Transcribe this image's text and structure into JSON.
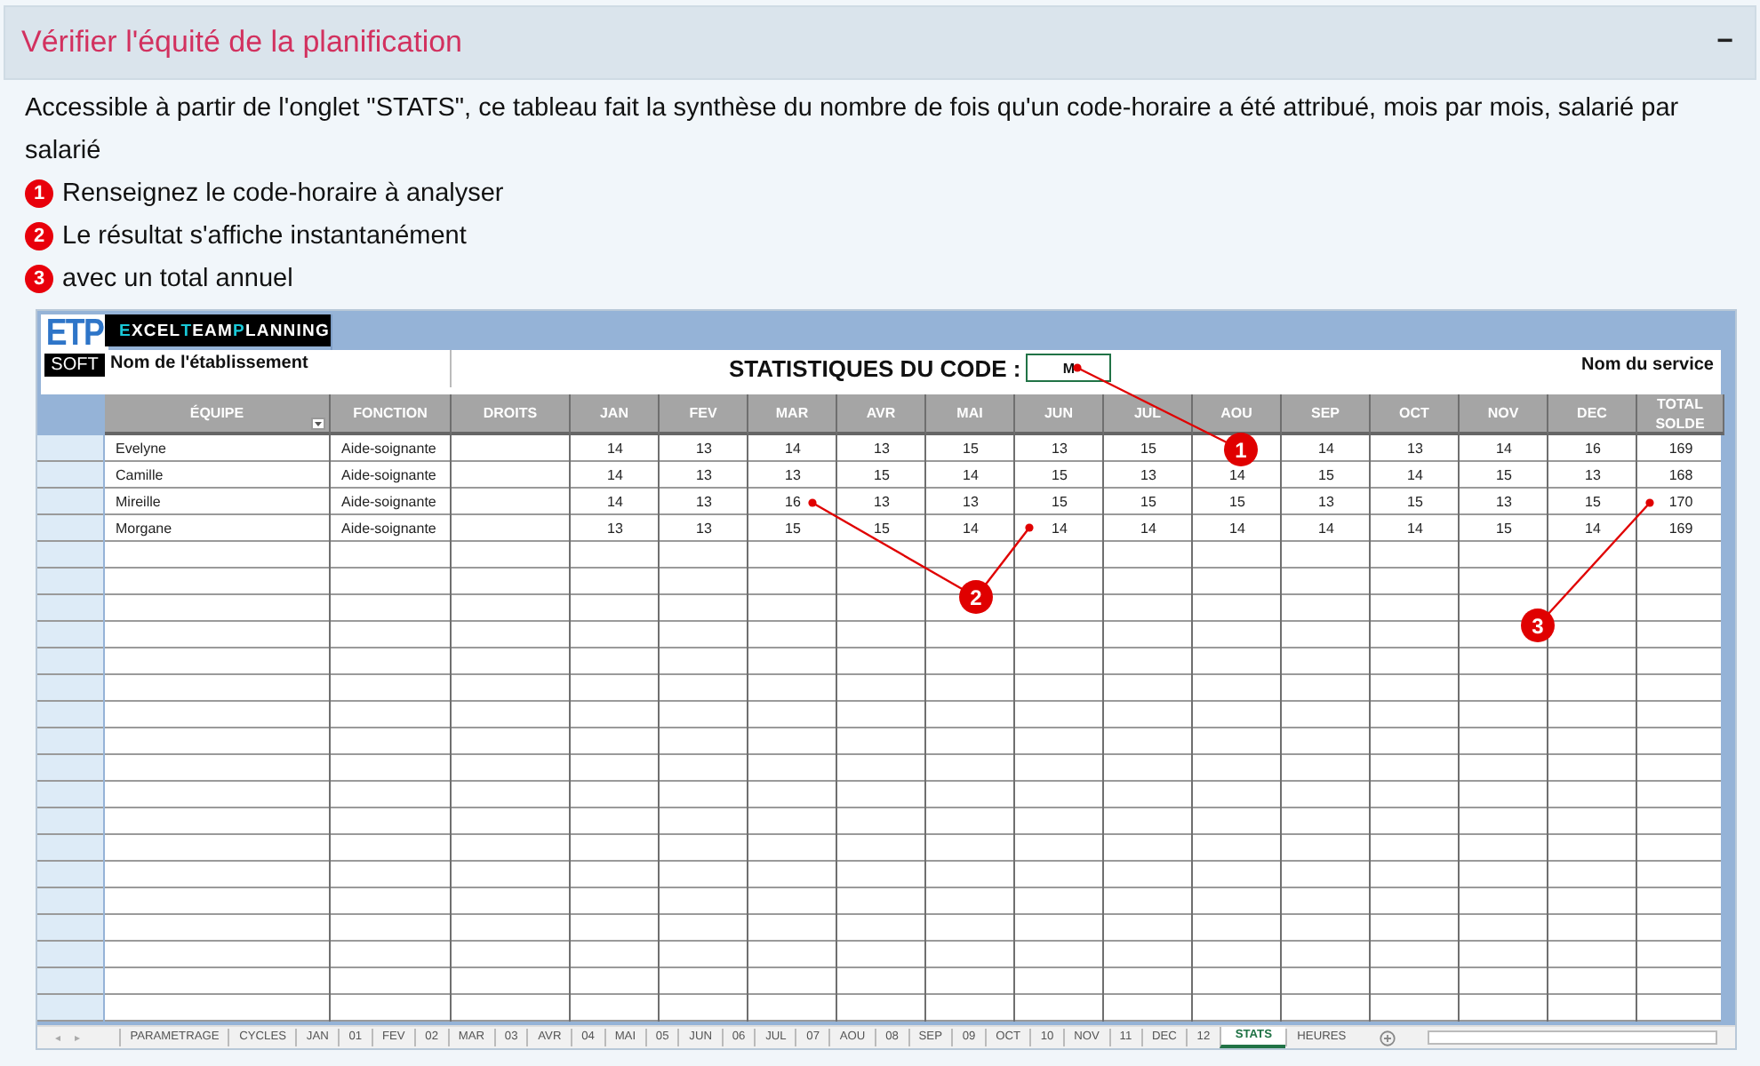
{
  "section": {
    "title": "Vérifier l'équité de la planification",
    "toggle": "−"
  },
  "intro": "Accessible à partir de l'onglet \"STATS\", ce tableau fait la synthèse du nombre de fois qu'un code-horaire a été attribué, mois par mois, salarié par salarié",
  "steps": [
    {
      "number": "1",
      "text": "Renseignez le code-horaire à analyser"
    },
    {
      "number": "2",
      "text": "Le résultat s'affiche instantanément"
    },
    {
      "number": "3",
      "text": "avec un total annuel"
    }
  ],
  "sheet": {
    "logo": {
      "top": "ETP",
      "bottom": "SOFT"
    },
    "brand": [
      {
        "text": "E",
        "accent": true
      },
      {
        "text": "XCEL",
        "accent": false
      },
      {
        "text": "T",
        "accent": true
      },
      {
        "text": "EAM",
        "accent": false
      },
      {
        "text": "P",
        "accent": true
      },
      {
        "text": "LANNING",
        "accent": false
      }
    ],
    "establishment": "Nom de l'établissement",
    "title": "STATISTIQUES DU CODE :",
    "code": "M",
    "service": "Nom du service",
    "columns": [
      "ÉQUIPE",
      "FONCTION",
      "DROITS",
      "JAN",
      "FEV",
      "MAR",
      "AVR",
      "MAI",
      "JUN",
      "JUL",
      "AOU",
      "SEP",
      "OCT",
      "NOV",
      "DEC",
      "TOTAL SOLDE"
    ],
    "rows": [
      {
        "name": "Evelyne",
        "function": "Aide-soignante",
        "values": {
          "jan": "14",
          "fev": "13",
          "mar": "14",
          "avr": "13",
          "mai": "15",
          "jun": "13",
          "jul": "15",
          "sep": "14",
          "oct": "13",
          "nov": "14",
          "dec": "16"
        },
        "total": "169"
      },
      {
        "name": "Camille",
        "function": "Aide-soignante",
        "values": {
          "jan": "14",
          "fev": "13",
          "mar": "13",
          "avr": "15",
          "mai": "14",
          "jun": "15",
          "jul": "13",
          "aou": "14",
          "sep": "15",
          "oct": "14",
          "nov": "15",
          "dec": "13"
        },
        "total": "168"
      },
      {
        "name": "Mireille",
        "function": "Aide-soignante",
        "values": {
          "jan": "14",
          "fev": "13",
          "mar": "16",
          "avr": "13",
          "mai": "13",
          "jun": "15",
          "jul": "15",
          "aou": "15",
          "sep": "13",
          "oct": "15",
          "nov": "13",
          "dec": "15"
        },
        "total": "170"
      },
      {
        "name": "Morgane",
        "function": "Aide-soignante",
        "values": {
          "jan": "13",
          "fev": "13",
          "mar": "15",
          "avr": "15",
          "mai": "14",
          "jun": "14",
          "jul": "14",
          "aou": "14",
          "sep": "14",
          "oct": "14",
          "nov": "15",
          "dec": "14"
        },
        "total": "169"
      }
    ],
    "nav": [
      "◂",
      "▸"
    ],
    "callouts": [
      {
        "label": "1"
      },
      {
        "label": "2"
      },
      {
        "label": "3"
      }
    ],
    "tabs": [
      {
        "label": "PARAMETRAGE",
        "selected": false
      },
      {
        "label": "CYCLES",
        "selected": false
      },
      {
        "label": "JAN",
        "selected": false
      },
      {
        "label": "01",
        "selected": false
      },
      {
        "label": "FEV",
        "selected": false
      },
      {
        "label": "02",
        "selected": false
      },
      {
        "label": "MAR",
        "selected": false
      },
      {
        "label": "03",
        "selected": false
      },
      {
        "label": "AVR",
        "selected": false
      },
      {
        "label": "04",
        "selected": false
      },
      {
        "label": "MAI",
        "selected": false
      },
      {
        "label": "05",
        "selected": false
      },
      {
        "label": "JUN",
        "selected": false
      },
      {
        "label": "06",
        "selected": false
      },
      {
        "label": "JUL",
        "selected": false
      },
      {
        "label": "07",
        "selected": false
      },
      {
        "label": "AOU",
        "selected": false
      },
      {
        "label": "08",
        "selected": false
      },
      {
        "label": "SEP",
        "selected": false
      },
      {
        "label": "09",
        "selected": false
      },
      {
        "label": "OCT",
        "selected": false
      },
      {
        "label": "10",
        "selected": false
      },
      {
        "label": "NOV",
        "selected": false
      },
      {
        "label": "11",
        "selected": false
      },
      {
        "label": "DEC",
        "selected": false
      },
      {
        "label": "12",
        "selected": false
      },
      {
        "label": "STATS",
        "selected": true
      },
      {
        "label": "HEURES",
        "selected": false
      }
    ]
  }
}
